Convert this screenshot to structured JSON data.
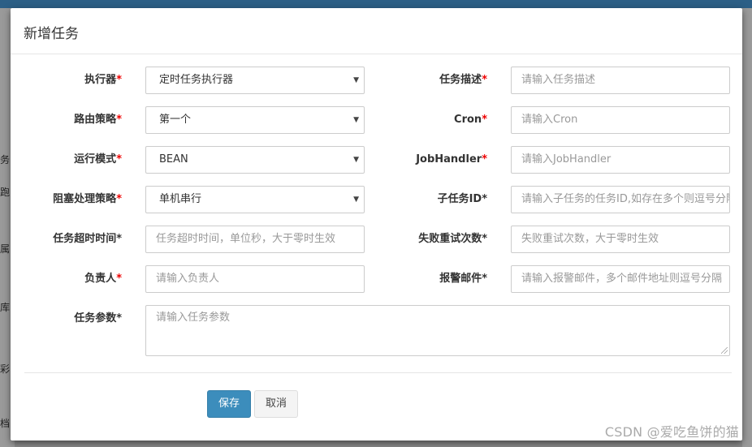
{
  "modal": {
    "title": "新增任务",
    "required_mark": "*"
  },
  "form": {
    "executor": {
      "label": "执行器",
      "value": "定时任务执行器"
    },
    "route_strategy": {
      "label": "路由策略",
      "value": "第一个"
    },
    "run_mode": {
      "label": "运行模式",
      "value": "BEAN"
    },
    "block_strategy": {
      "label": "阻塞处理策略",
      "value": "单机串行"
    },
    "timeout": {
      "label": "任务超时时间*",
      "placeholder": "任务超时时间，单位秒，大于零时生效"
    },
    "owner": {
      "label": "负责人",
      "placeholder": "请输入负责人"
    },
    "job_params": {
      "label": "任务参数*",
      "placeholder": "请输入任务参数"
    },
    "job_desc": {
      "label": "任务描述",
      "placeholder": "请输入任务描述"
    },
    "cron": {
      "label": "Cron",
      "placeholder": "请输入Cron"
    },
    "job_handler": {
      "label": "JobHandler",
      "placeholder": "请输入JobHandler"
    },
    "child_job_id": {
      "label": "子任务ID*",
      "placeholder": "请输入子任务的任务ID,如存在多个则逗号分隔"
    },
    "retry_count": {
      "label": "失败重试次数*",
      "placeholder": "失败重试次数，大于零时生效"
    },
    "alarm_email": {
      "label": "报警邮件*",
      "placeholder": "请输入报警邮件，多个邮件地址则逗号分隔"
    }
  },
  "buttons": {
    "save": "保存",
    "cancel": "取消"
  },
  "background": {
    "side_chars": [
      "务",
      "跑",
      "属",
      "库",
      "彩",
      "档"
    ]
  },
  "watermark": "CSDN @爱吃鱼饼的猫",
  "colors": {
    "primary": "#3c8dbc",
    "required": "#ee0000",
    "topbar": "#2c5f86"
  }
}
